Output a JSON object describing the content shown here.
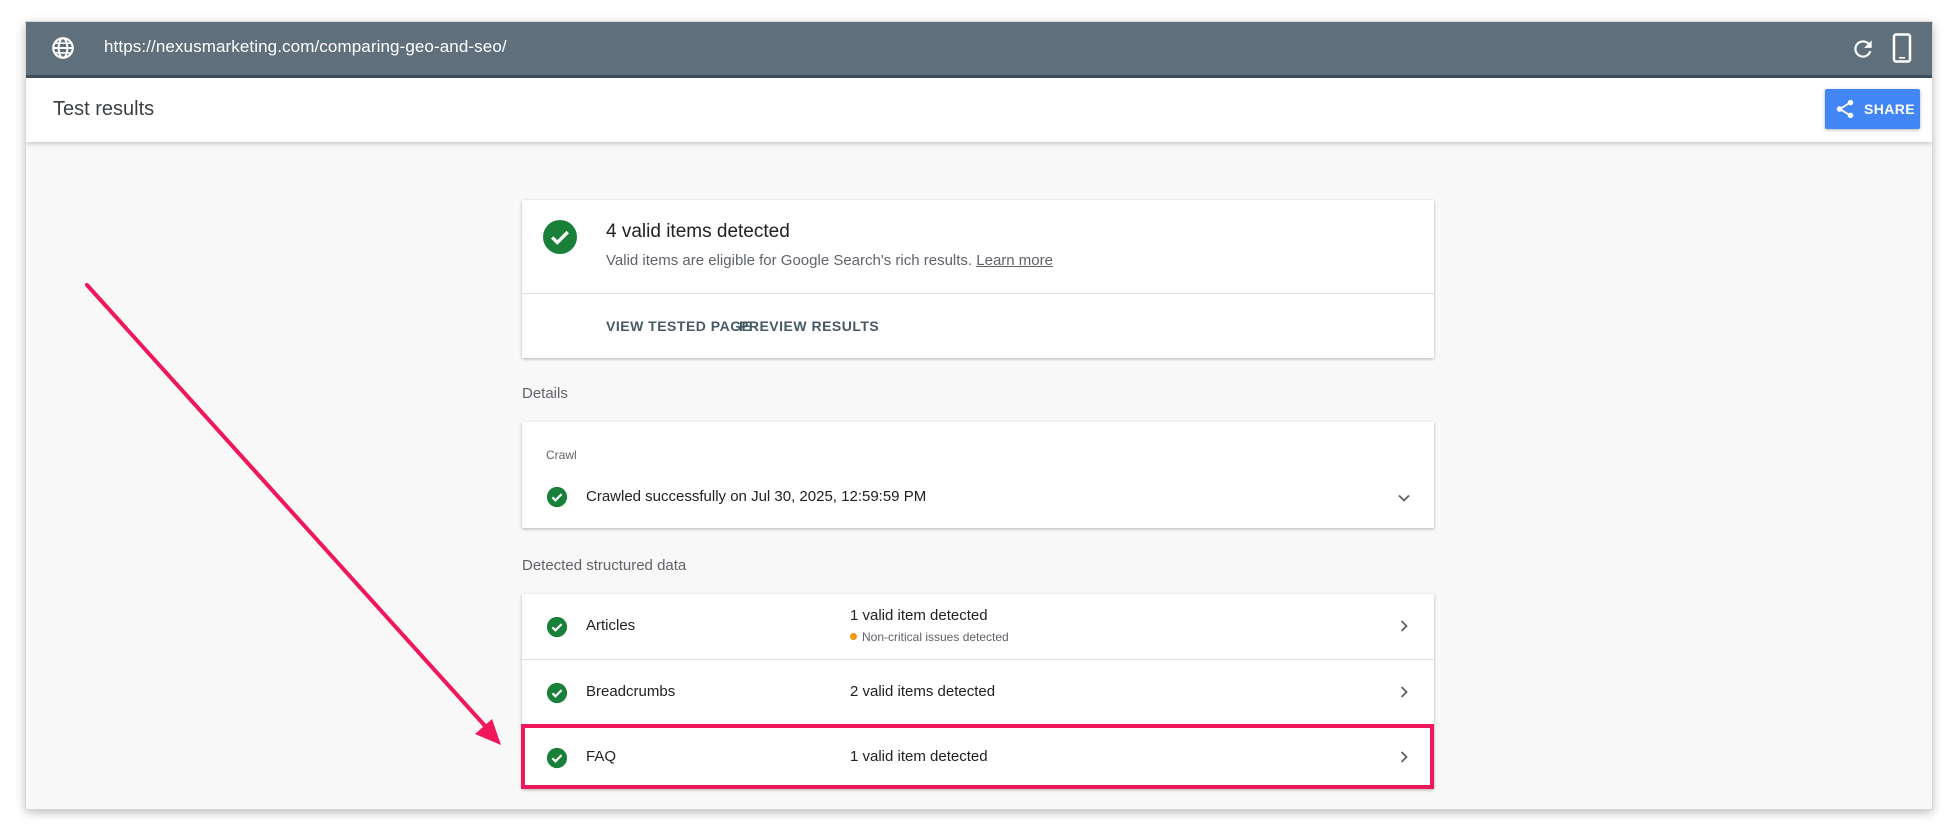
{
  "url_bar": {
    "url": "https://nexusmarketing.com/comparing-geo-and-seo/"
  },
  "header": {
    "title": "Test results",
    "share_label": "SHARE"
  },
  "summary": {
    "headline": "4 valid items detected",
    "subtext": "Valid items are eligible for Google Search's rich results.",
    "learn_more": "Learn more",
    "actions": {
      "view_tested_page": "VIEW TESTED PAGE",
      "preview_results": "PREVIEW RESULTS"
    }
  },
  "details": {
    "label": "Details",
    "crawl": {
      "heading": "Crawl",
      "status": "Crawled successfully on Jul 30, 2025, 12:59:59 PM"
    }
  },
  "structured_data": {
    "label": "Detected structured data",
    "items": [
      {
        "name": "Articles",
        "status": "1 valid item detected",
        "note": "Non-critical issues detected"
      },
      {
        "name": "Breadcrumbs",
        "status": "2 valid items detected"
      },
      {
        "name": "FAQ",
        "status": "1 valid item detected"
      }
    ]
  },
  "colors": {
    "url_bar": "#5f6f7b",
    "share_button": "#4285f4",
    "valid_check": "#188038",
    "warning_dot": "#f29900",
    "annotation": "#f0175a"
  },
  "icons": [
    "globe-icon",
    "reload-icon",
    "mobile-device-icon",
    "share-icon",
    "check-circle-icon",
    "chevron-down-icon",
    "chevron-right-icon"
  ]
}
